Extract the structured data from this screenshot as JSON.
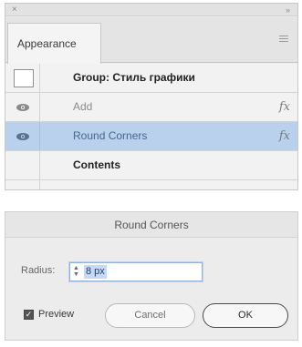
{
  "panel": {
    "title_icons": {
      "close": "×",
      "collapse": "»"
    },
    "tab_label": "Appearance",
    "menu_icon": "panel-menu-icon",
    "rows": [
      {
        "kind": "group",
        "label": "Group: Стиль графики"
      },
      {
        "kind": "effect",
        "label": "Add",
        "fx": "fx"
      },
      {
        "kind": "effect",
        "label": "Round Corners",
        "fx": "fx",
        "selected": true
      },
      {
        "kind": "contents",
        "label": "Contents"
      }
    ]
  },
  "dialog": {
    "title": "Round Corners",
    "radius_label": "Radius:",
    "radius_value": "8 px",
    "preview_label": "Preview",
    "preview_checked": true,
    "cancel_label": "Cancel",
    "ok_label": "OK"
  }
}
